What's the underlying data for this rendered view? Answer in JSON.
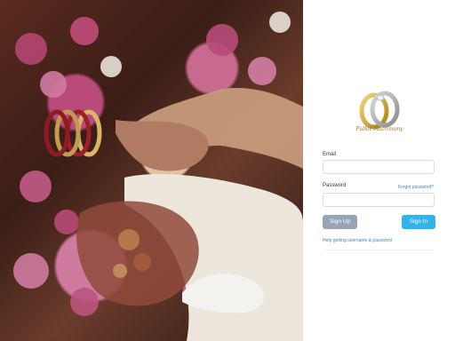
{
  "hero": {
    "alt": "wedding hands photo"
  },
  "brand": {
    "name": "Pulkit Matrimony"
  },
  "form": {
    "email_label": "Email",
    "email_value": "",
    "password_label": "Password",
    "password_value": "",
    "forgot_link": "Forgot password?",
    "signup_label": "Sign Up",
    "signin_label": "Sign In",
    "help_link": "Help getting username & password"
  },
  "colors": {
    "primary": "#34b3ea",
    "secondary": "#95a5b7",
    "link": "#3d86c6",
    "logo_gold": "#c9a33a"
  }
}
